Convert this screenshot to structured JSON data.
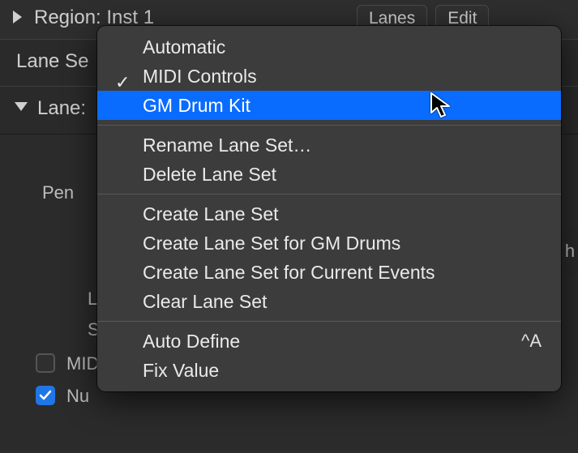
{
  "header": {
    "region_label": "Region: Inst 1",
    "lanes_button": "Lanes",
    "edit_button": "Edit"
  },
  "sidebar": {
    "lane_set_label": "Lane Se",
    "lane_label": "Lane:",
    "pen_label": "Pen",
    "l_label": "L",
    "s_label": "S",
    "midi_label": "MIDI",
    "number_label": "Nu",
    "midi_checked": false,
    "number_checked": true,
    "right_h": "h"
  },
  "menu": {
    "items": [
      {
        "label": "Automatic",
        "checked": false
      },
      {
        "label": "MIDI Controls",
        "checked": true
      },
      {
        "label": "GM Drum Kit",
        "checked": false,
        "highlight": true
      }
    ],
    "group2": [
      {
        "label": "Rename Lane Set…"
      },
      {
        "label": "Delete Lane Set"
      }
    ],
    "group3": [
      {
        "label": "Create Lane Set"
      },
      {
        "label": "Create Lane Set for GM Drums"
      },
      {
        "label": "Create Lane Set for Current Events"
      },
      {
        "label": "Clear Lane Set"
      }
    ],
    "group4": [
      {
        "label": "Auto Define",
        "shortcut": "^A"
      },
      {
        "label": "Fix Value"
      }
    ]
  }
}
